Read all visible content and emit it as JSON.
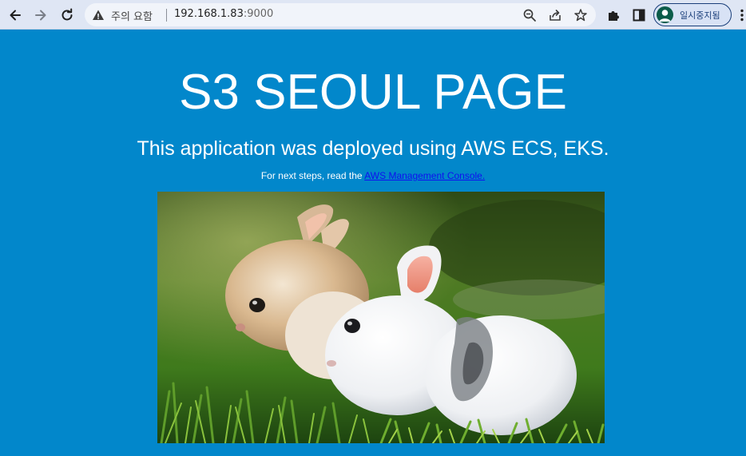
{
  "browser": {
    "security_label": "주의 요함",
    "url_host": "192.168.1.83",
    "url_port": ":9000",
    "profile_label": "일시중지됨",
    "icons": [
      "back-icon",
      "forward-icon",
      "reload-icon",
      "warning-icon",
      "zoom-icon",
      "share-icon",
      "star-icon",
      "extensions-icon",
      "side-panel-icon",
      "avatar-icon",
      "menu-icon"
    ]
  },
  "page": {
    "title": "S3 SEOUL PAGE",
    "subtitle": "This application was deployed using AWS ECS, EKS.",
    "note_prefix": "For next steps, read the ",
    "note_link": "AWS Management Console.",
    "background_color": "#0287cb",
    "image_alt": "two rabbits on grass"
  }
}
